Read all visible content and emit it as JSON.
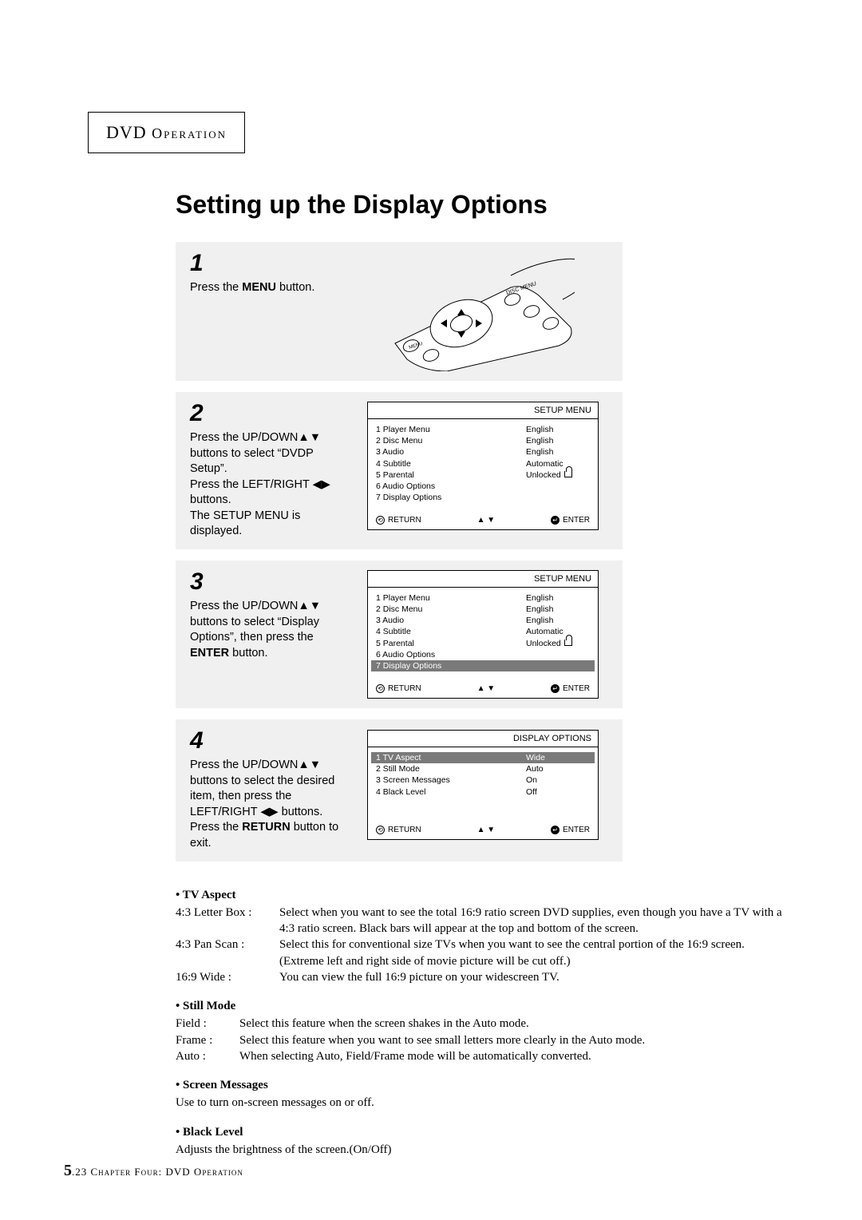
{
  "header": {
    "prefix": "DVD ",
    "suffix": "Operation"
  },
  "title": "Setting up the Display Options",
  "steps": [
    {
      "num": "1",
      "html": "Press the <b>MENU</b> button."
    },
    {
      "num": "2",
      "html": "Press the UP/DOWN▲▼ buttons to select “DVDP Setup”.<br>Press the LEFT/RIGHT ◀▶ buttons.<br>The SETUP MENU is displayed."
    },
    {
      "num": "3",
      "html": "Press the UP/DOWN▲▼ buttons to select “Display Options”, then press the <b>ENTER</b> button."
    },
    {
      "num": "4",
      "html": "Press the UP/DOWN▲▼ buttons to select the desired item, then press the LEFT/RIGHT ◀▶ buttons. Press the <b>RETURN</b> button to exit."
    }
  ],
  "osd": {
    "setup_title": "SETUP  MENU",
    "display_title": "DISPLAY  OPTIONS",
    "footer_return": "RETURN",
    "footer_updown": "▲ ▼",
    "footer_enter": "ENTER",
    "setup_rows": [
      {
        "l": "1  Player Menu",
        "r": "English"
      },
      {
        "l": "2  Disc Menu",
        "r": "English"
      },
      {
        "l": "3  Audio",
        "r": "English"
      },
      {
        "l": "4  Subtitle",
        "r": "Automatic"
      },
      {
        "l": "5  Parental",
        "r": "Unlocked",
        "lock": true
      },
      {
        "l": "6  Audio Options",
        "r": ""
      },
      {
        "l": "7  Display Options",
        "r": ""
      }
    ],
    "step3_highlight_index": 6,
    "display_rows": [
      {
        "l": "1  TV Aspect",
        "r": "Wide"
      },
      {
        "l": "2  Still Mode",
        "r": "Auto"
      },
      {
        "l": "3  Screen Messages",
        "r": "On"
      },
      {
        "l": "4  Black Level",
        "r": "Off"
      }
    ],
    "step4_highlight_index": 0
  },
  "explain": {
    "tv_aspect": {
      "title": "TV Aspect",
      "rows": [
        {
          "label": "4:3 Letter Box :",
          "text": "Select when you want to see the total 16:9 ratio screen DVD supplies, even though you have a TV with a 4:3 ratio screen. Black bars will appear at the top and bottom of the screen."
        },
        {
          "label": "4:3 Pan Scan :",
          "text": "Select this for conventional size TVs when you want to see the central portion of the 16:9 screen. (Extreme left and right side of movie picture will be cut off.)"
        },
        {
          "label": "16:9 Wide :",
          "text": "You can view the full 16:9 picture on your widescreen TV."
        }
      ]
    },
    "still_mode": {
      "title": "Still Mode",
      "rows": [
        {
          "label": "Field :",
          "text": "Select this feature when the screen shakes in the Auto mode."
        },
        {
          "label": "Frame :",
          "text": "Select this feature when you want to see small letters more clearly in the Auto mode."
        },
        {
          "label": "Auto :",
          "text": "When selecting Auto, Field/Frame mode will be automatically converted."
        }
      ]
    },
    "screen_messages": {
      "title": "Screen Messages",
      "text": "Use to turn on-screen messages on or off."
    },
    "black_level": {
      "title": "Black Level",
      "text": "Adjusts the brightness of the screen.(On/Off)"
    }
  },
  "footer": {
    "page_major": "5",
    "page_minor": ".23 ",
    "chapter": "Chapter Four: DVD Operation"
  }
}
